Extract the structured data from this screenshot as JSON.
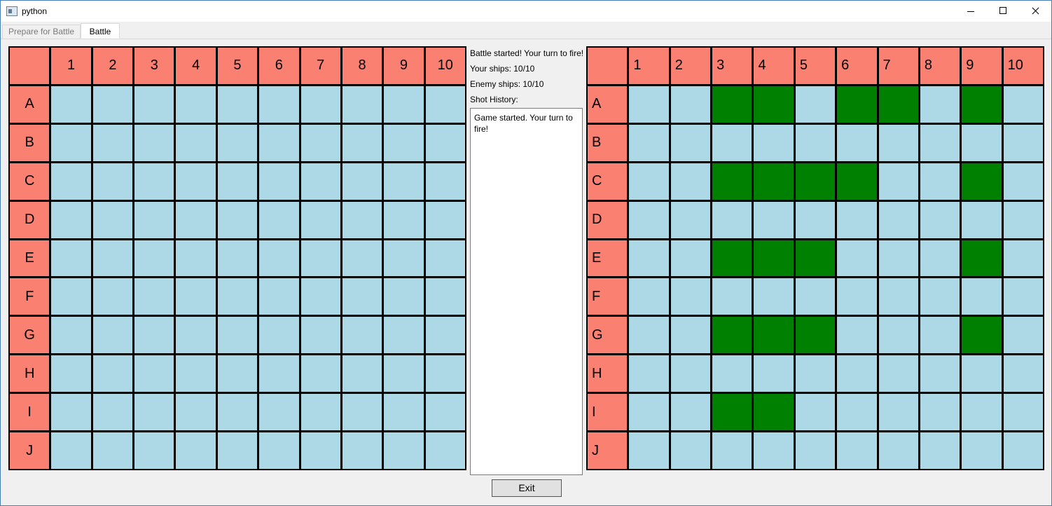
{
  "window": {
    "title": "python"
  },
  "tabs": [
    {
      "label": "Prepare for Battle",
      "active": false
    },
    {
      "label": "Battle",
      "active": true
    }
  ],
  "status": {
    "message": "Battle started! Your turn to fire!",
    "your_ships": "Your ships: 10/10",
    "enemy_ships": "Enemy ships: 10/10",
    "history_label": "Shot History:",
    "history_text": "Game started. Your turn to fire!"
  },
  "exit_button": {
    "label": "Exit"
  },
  "grid_labels": {
    "columns": [
      "1",
      "2",
      "3",
      "4",
      "5",
      "6",
      "7",
      "8",
      "9",
      "10"
    ],
    "rows": [
      "A",
      "B",
      "C",
      "D",
      "E",
      "F",
      "G",
      "H",
      "I",
      "J"
    ]
  },
  "left_board": {
    "name": "enemy",
    "ships": []
  },
  "right_board": {
    "name": "player",
    "ships": [
      "A3",
      "A4",
      "A6",
      "A7",
      "A9",
      "C3",
      "C4",
      "C5",
      "C6",
      "C9",
      "E3",
      "E4",
      "E5",
      "E9",
      "G3",
      "G4",
      "G5",
      "G9",
      "I3",
      "I4"
    ]
  },
  "colors": {
    "header": "#fa8072",
    "water": "#add8e6",
    "ship": "#008000",
    "grid_line": "#000000"
  }
}
